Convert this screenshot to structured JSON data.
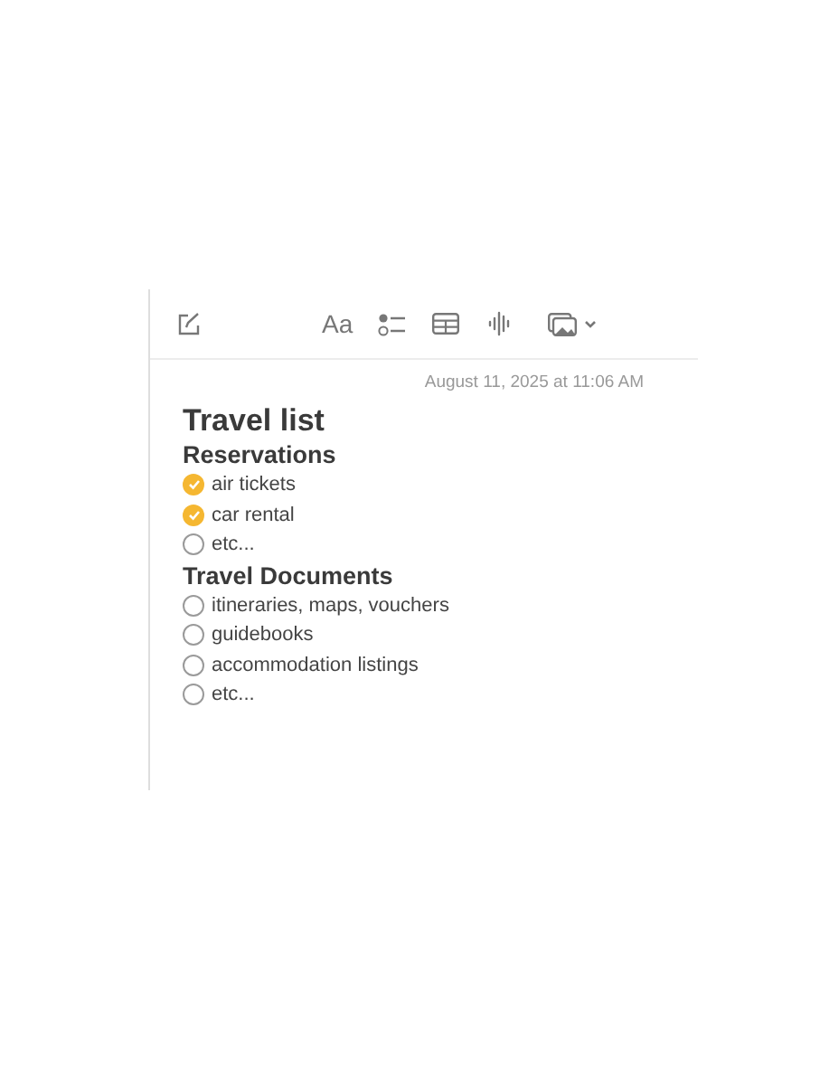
{
  "toolbar": {
    "format_label": "Aa"
  },
  "timestamp": "August 11, 2025 at 11:06 AM",
  "note": {
    "title": "Travel list",
    "sections": [
      {
        "heading": "Reservations",
        "items": [
          {
            "text": "air tickets",
            "checked": true
          },
          {
            "text": "car rental",
            "checked": true
          },
          {
            "text": "etc...",
            "checked": false
          }
        ]
      },
      {
        "heading": "Travel Documents",
        "items": [
          {
            "text": "itineraries, maps, vouchers",
            "checked": false
          },
          {
            "text": "guidebooks",
            "checked": false
          },
          {
            "text": "accommodation listings",
            "checked": false
          },
          {
            "text": "etc...",
            "checked": false
          }
        ]
      }
    ]
  }
}
